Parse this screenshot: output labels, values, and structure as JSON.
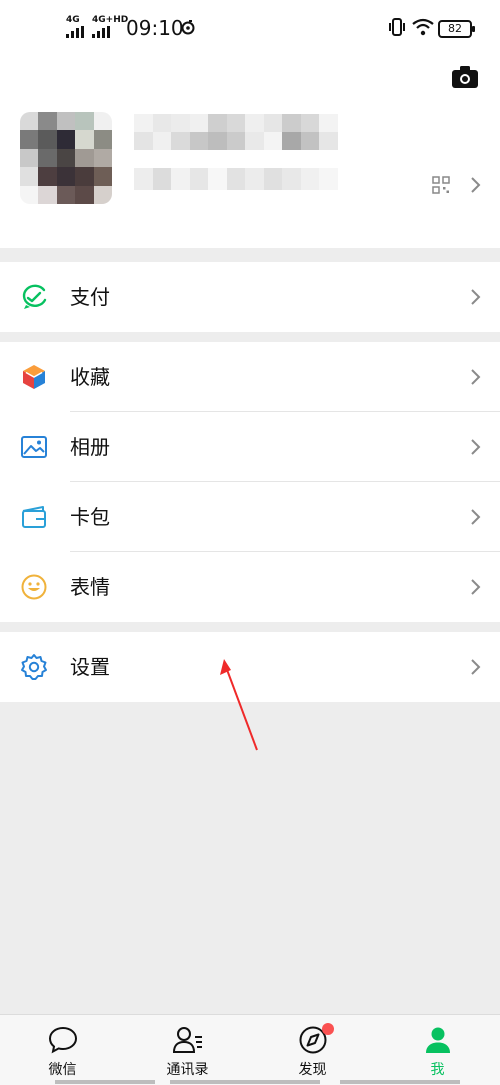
{
  "status_bar": {
    "sim1": "4G",
    "sim2": "4G+HD",
    "time": "09:10",
    "battery": "82"
  },
  "menu": {
    "pay": "支付",
    "favorites": "收藏",
    "album": "相册",
    "cards": "卡包",
    "stickers": "表情",
    "settings": "设置"
  },
  "tabs": {
    "chats": "微信",
    "contacts": "通讯录",
    "discover": "发现",
    "me": "我"
  },
  "colors": {
    "accent": "#07c160",
    "badge": "#fa5151",
    "annotation_arrow": "#ef2a2a"
  },
  "icons": [
    "camera-icon",
    "qr-code-icon",
    "wallet-icon",
    "cube-icon",
    "image-icon",
    "card-icon",
    "smile-icon",
    "gear-icon",
    "chat-icon",
    "contacts-icon",
    "compass-icon",
    "person-icon"
  ]
}
